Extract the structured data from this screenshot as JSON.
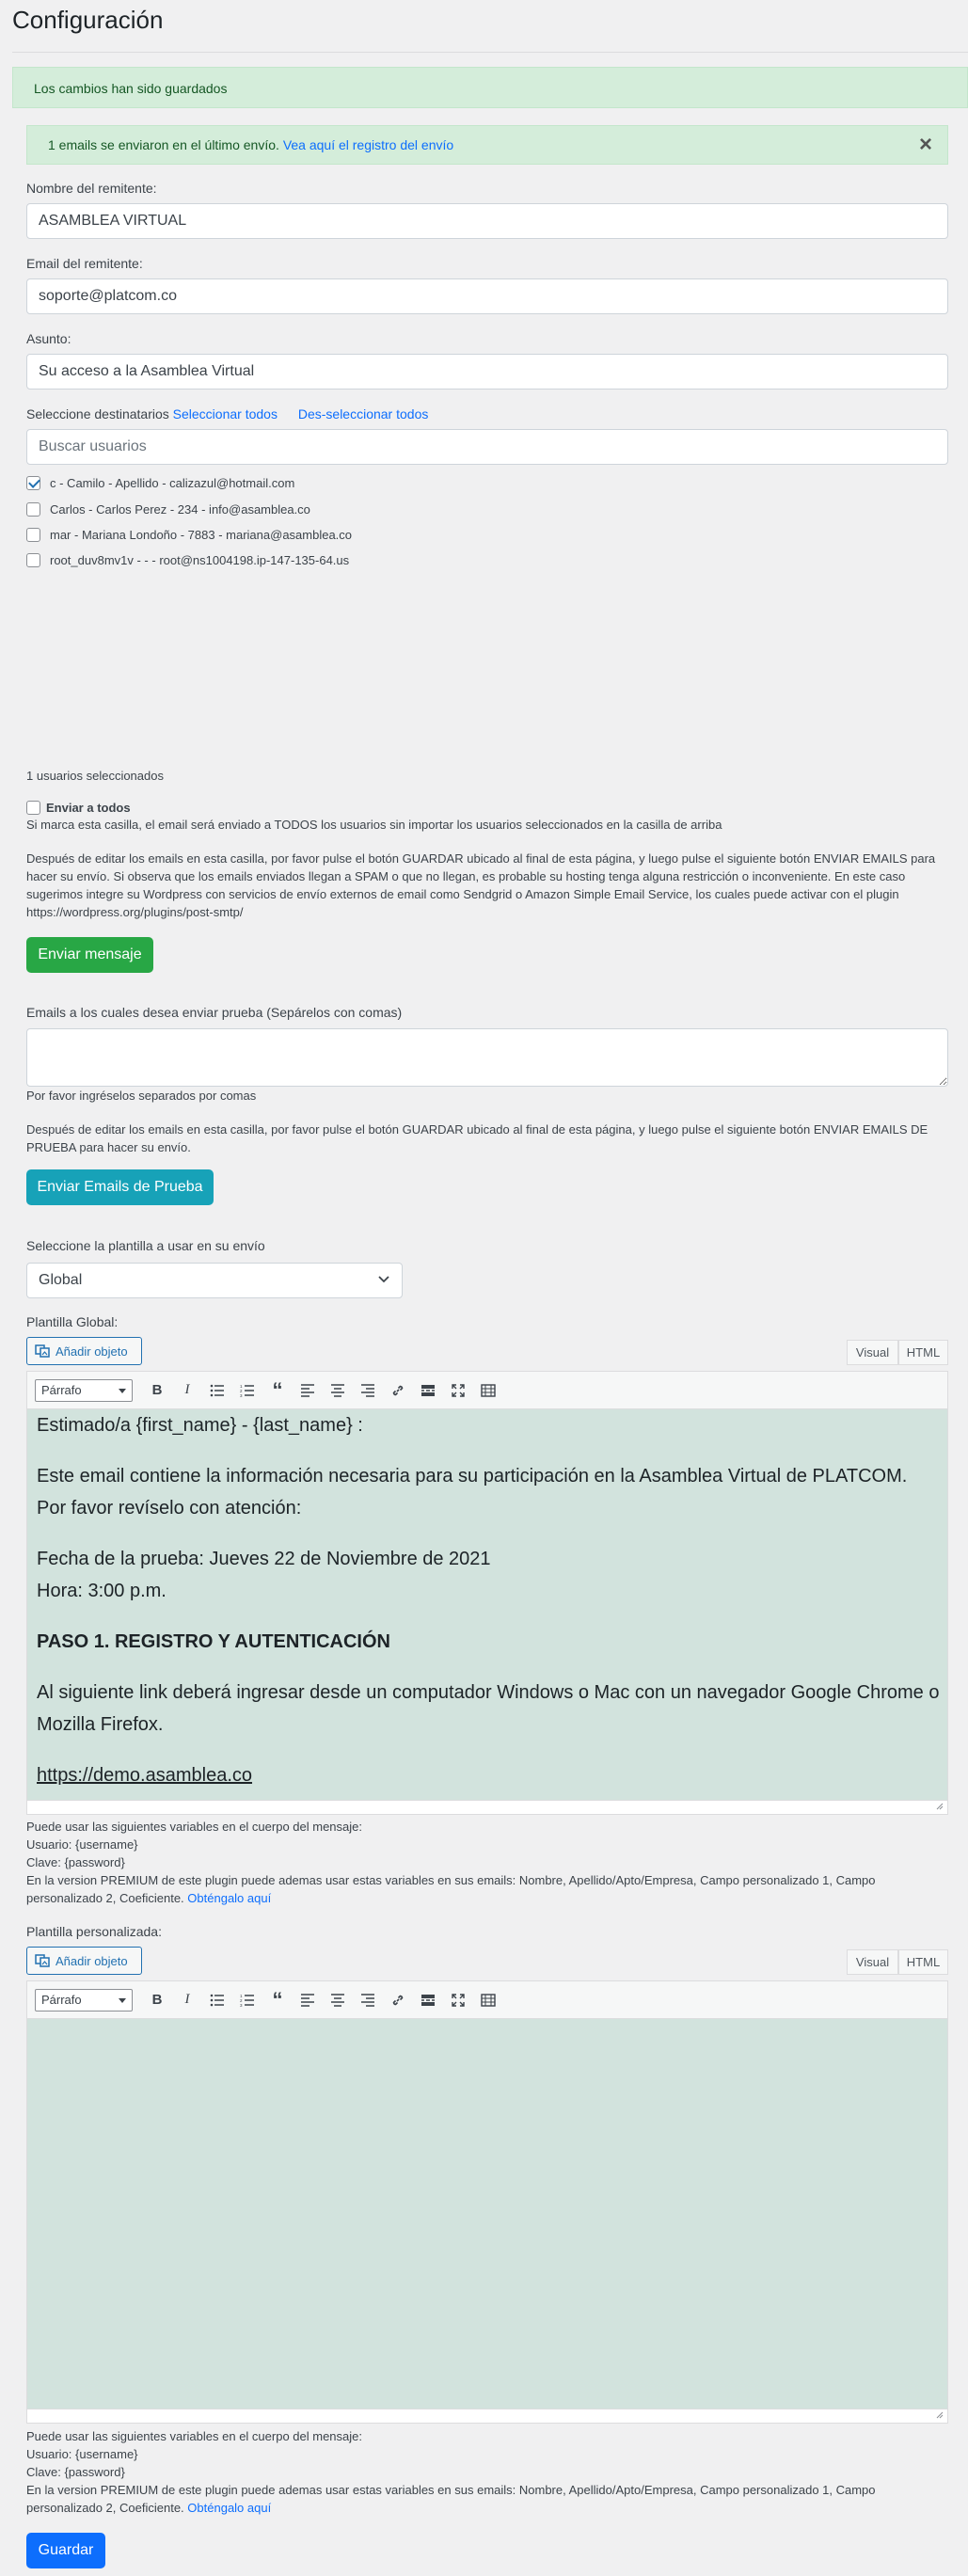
{
  "page_title": "Configuración",
  "notices": {
    "saved": "Los cambios han sido guardados",
    "sent_text": "1 emails se enviaron en el último envío.",
    "sent_link": "Vea aquí el registro del envío",
    "close": "×"
  },
  "form": {
    "sender_name_label": "Nombre del remitente:",
    "sender_name_value": "ASAMBLEA VIRTUAL",
    "sender_email_label": "Email del remitente:",
    "sender_email_value": "soporte@platcom.co",
    "subject_label": "Asunto:",
    "subject_value": "Su acceso a la Asamblea Virtual",
    "recipients_label": "Seleccione destinatarios",
    "select_all": "Seleccionar todos",
    "deselect_all": "Des-seleccionar todos",
    "search_placeholder": "Buscar usuarios",
    "users": [
      {
        "label": "c - Camilo - Apellido - calizazul@hotmail.com",
        "checked": true
      },
      {
        "label": "Carlos - Carlos Perez - 234 - info@asamblea.co",
        "checked": false
      },
      {
        "label": "mar - Mariana Londoño - 7883 - mariana@asamblea.co",
        "checked": false
      },
      {
        "label": "root_duv8mv1v - - - root@ns1004198.ip-147-135-64.us",
        "checked": false
      }
    ],
    "selected_count": "1 usuarios seleccionados",
    "send_all_label": "Enviar a todos",
    "send_all_help": "Si marca esta casilla, el email será enviado a TODOS los usuarios sin importar los usuarios seleccionados en la casilla de arriba",
    "send_instructions": "Después de editar los emails en esta casilla, por favor pulse el botón GUARDAR ubicado al final de esta página, y luego pulse el siguiente botón ENVIAR EMAILS para hacer su envío. Si observa que los emails enviados llegan a SPAM o que no llegan, es probable su hosting tenga alguna restricción o inconveniente. En este caso sugerimos integre su Wordpress con servicios de envío externos de email como Sendgrid o Amazon Simple Email Service, los cuales puede activar con el plugin https://wordpress.org/plugins/post-smtp/",
    "send_button": "Enviar mensaje",
    "test_label": "Emails a los cuales desea enviar prueba (Sepárelos con comas)",
    "test_help": "Por favor ingréselos separados por comas",
    "test_instructions": "Después de editar los emails en esta casilla, por favor pulse el botón GUARDAR ubicado al final de esta página, y luego pulse el siguiente botón ENVIAR EMAILS DE PRUEBA para hacer su envío.",
    "test_button": "Enviar Emails de Prueba",
    "template_label": "Seleccione la plantilla a usar en su envío",
    "template_value": "Global",
    "global_template_label": "Plantilla Global:",
    "custom_template_label": "Plantilla personalizada:",
    "add_media": "Añadir objeto",
    "tab_visual": "Visual",
    "tab_html": "HTML",
    "format_select": "Párrafo",
    "global_content": {
      "greeting": "Estimado/a {first_name} - {last_name} :",
      "intro": "Este email contiene la información necesaria para su participación en la Asamblea Virtual de PLATCOM. Por favor revíselo con atención:",
      "date": "Fecha de la prueba: Jueves 22 de Noviembre de 2021",
      "time": "Hora: 3:00 p.m.",
      "step1": "PASO 1. REGISTRO Y AUTENTICACIÓN",
      "step1_text": "Al siguiente link deberá ingresar desde un computador Windows o Mac con un navegador Google Chrome o Mozilla Firefox.",
      "link": "https://demo.asamblea.co"
    },
    "vars_intro": "Puede usar las siguientes variables en el cuerpo del mensaje:",
    "vars_user": "Usuario: {username}",
    "vars_pass": "Clave: {password}",
    "vars_premium": "En la version PREMIUM de este plugin puede ademas usar estas variables en sus emails: Nombre, Apellido/Apto/Empresa, Campo personalizado 1, Campo personalizado 2, Coeficiente.",
    "vars_premium_link": "Obténgalo aquí",
    "save_button": "Guardar"
  }
}
